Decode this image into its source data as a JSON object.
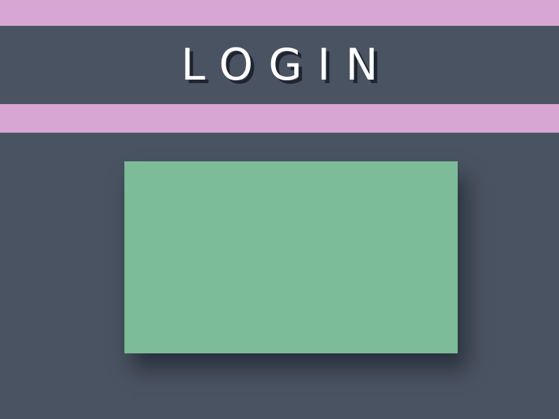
{
  "header": {
    "title": "LOGIN"
  },
  "colors": {
    "background": "#4a5361",
    "accent_band": "#d8a6d3",
    "card": "#7cbc99",
    "title_text": "#ffffff"
  }
}
